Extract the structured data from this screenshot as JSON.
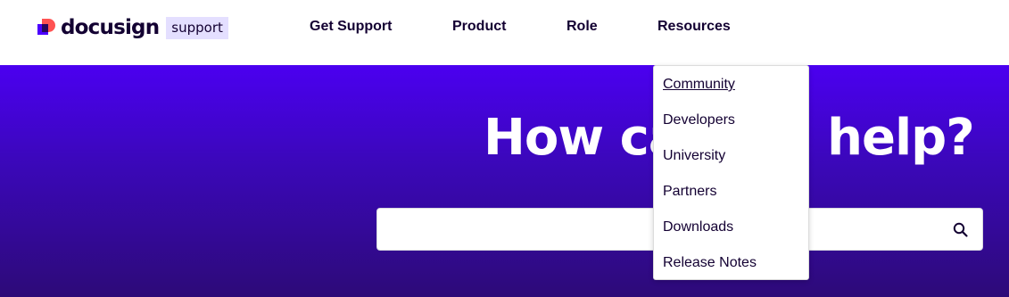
{
  "brand": {
    "name": "docusign",
    "badge": "support"
  },
  "nav": {
    "items": [
      {
        "label": "Get Support"
      },
      {
        "label": "Product"
      },
      {
        "label": "Role"
      },
      {
        "label": "Resources"
      }
    ]
  },
  "hero": {
    "title": "How can we help?"
  },
  "search": {
    "placeholder": "",
    "value": "",
    "icon": "search-icon"
  },
  "resources_menu": {
    "items": [
      {
        "label": "Community",
        "hovered": true
      },
      {
        "label": "Developers"
      },
      {
        "label": "University"
      },
      {
        "label": "Partners"
      },
      {
        "label": "Downloads"
      },
      {
        "label": "Release Notes"
      }
    ]
  },
  "colors": {
    "brand_purple": "#4c00ff",
    "brand_coral": "#ff5252",
    "text_dark": "#130032",
    "support_badge_bg": "#e4dfff",
    "hero_top": "#4b00f0",
    "hero_bottom": "#2d0a78"
  }
}
